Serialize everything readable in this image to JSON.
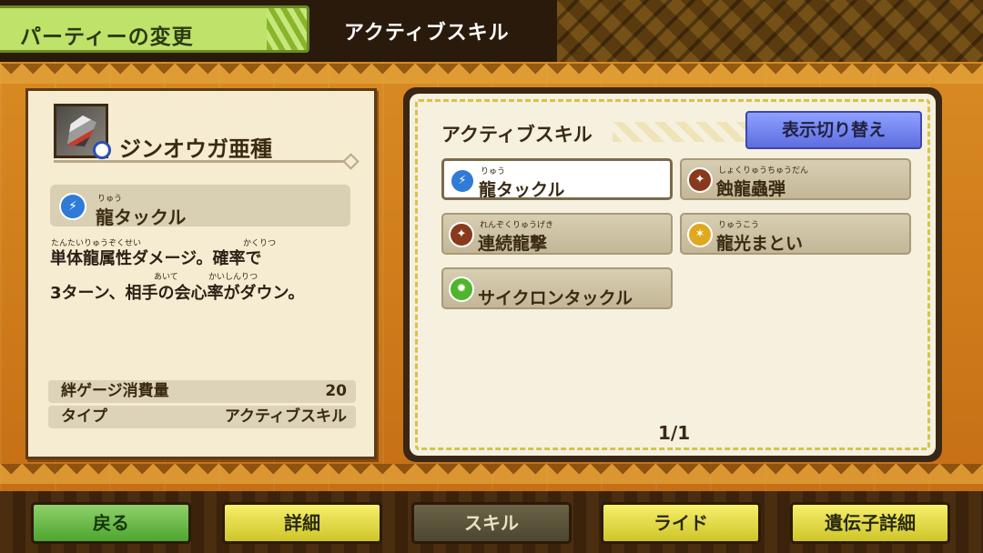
{
  "header": {
    "title": "パーティーの変更",
    "subtitle": "アクティブスキル"
  },
  "detail": {
    "monster_name": "ジンオウガ亜種",
    "skill": {
      "name": "龍タックル",
      "ruby": "りゅう",
      "icon": "run-icon"
    },
    "description": "単体龍属性ダメージ。確率で\n3ターン、相手の会心率がダウン。",
    "ruby": [
      "たんたいりゅうぞくせい",
      "かくりつ",
      "あいて",
      "かいしんりつ"
    ],
    "stats": {
      "cost_label": "絆ゲージ消費量",
      "cost_value": "20",
      "type_label": "タイプ",
      "type_value": "アクティブスキル"
    }
  },
  "skills_panel": {
    "title": "アクティブスキル",
    "toggle_label": "表示切り替え",
    "page": "1/1",
    "skills": [
      {
        "name": "龍タックル",
        "ruby": "りゅう",
        "icon": "run-icon",
        "color": "#2f7bd6",
        "selected": true
      },
      {
        "name": "蝕龍蟲弾",
        "ruby": "しょくりゅうちゅうだん",
        "icon": "claw-icon",
        "color": "#8a3a1c",
        "selected": false
      },
      {
        "name": "連続龍撃",
        "ruby": "れんぞくりゅうげき",
        "icon": "claw-icon",
        "color": "#8a3a1c",
        "selected": false
      },
      {
        "name": "龍光まとい",
        "ruby": "りゅうこう",
        "icon": "power-icon",
        "color": "#e0a81f",
        "selected": false
      },
      {
        "name": "サイクロンタックル",
        "ruby": "",
        "icon": "burst-icon",
        "color": "#4fb52d",
        "selected": false
      }
    ]
  },
  "footer": {
    "back": "戻る",
    "details": "詳細",
    "skill": "スキル",
    "ride": "ライド",
    "gene_details": "遺伝子詳細"
  },
  "colors": {
    "accent_green": "#bfe26a",
    "toggle_blue": "#6f80f0",
    "button_yellow": "#e6dd4a",
    "button_green": "#6fbf4c"
  }
}
